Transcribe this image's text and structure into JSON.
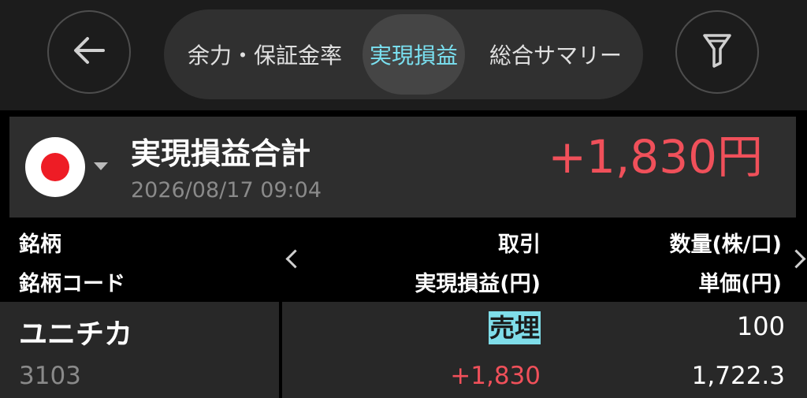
{
  "header": {
    "back_icon": "arrow-left-icon",
    "filter_icon": "funnel-filter-icon",
    "tabs": [
      {
        "label": "余力・保証金率",
        "active": false
      },
      {
        "label": "実現損益",
        "active": true
      },
      {
        "label": "総合サマリー",
        "active": false
      }
    ]
  },
  "summary": {
    "flag_icon": "japan-flag-icon",
    "title": "実現損益合計",
    "datetime": "2026/08/17 09:04",
    "amount": "+1,830円"
  },
  "columns": {
    "left_line1": "銘柄",
    "left_line2": "銘柄コード",
    "mid_line1": "取引",
    "mid_line2": "実現損益(円)",
    "right_line1": "数量(株/口)",
    "right_line2": "単価(円)"
  },
  "rows": [
    {
      "name": "ユニチカ",
      "code": "3103",
      "trade": "売埋",
      "quantity": "100",
      "realized_pl": "+1,830",
      "unit_price": "1,722.3"
    }
  ],
  "colors": {
    "accent_cyan": "#7ae0f0",
    "profit_red": "#f0505a",
    "badge_bg": "#7fdde9"
  }
}
